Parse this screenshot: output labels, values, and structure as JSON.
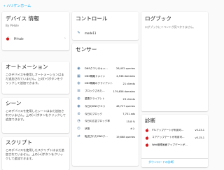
{
  "back_link": "ハリケンホーム",
  "device_info": {
    "title": "デバイス 情報",
    "subtitle": "By PiHole",
    "device_name": "PI-hole"
  },
  "automation": {
    "title": "オートメーション",
    "text": "このデバイスを使用しオートメーションはまだ追加されていません。上の[+]ボタンをクリックして追加できます。"
  },
  "scene": {
    "title": "シーン",
    "text": "このデバイスを使用したシーンはまだ追加されていません。上の[+]ボタンをクリックして追加できます。"
  },
  "script": {
    "title": "スクリプト",
    "text": "このデバイスを使用したスクリプトはまだ追加されていません。上の[+]ボタンをクリックして追加できます。"
  },
  "controls": {
    "title": "コントロール",
    "items": [
      {
        "label": "mode11"
      }
    ]
  },
  "sensors": {
    "title": "センサー",
    "items": [
      {
        "icon": "dns-icon",
        "name": "DNSクエリのキャ...",
        "value": "26,452 queries"
      },
      {
        "icon": "domain-icon",
        "name": "DNS隔離ドメイン",
        "value": "4,538 domains"
      },
      {
        "icon": "client-icon",
        "name": "DNS隔離のクライアント",
        "value": "21 clients"
      },
      {
        "icon": "list-icon",
        "name": "ブロックされた...",
        "value": "179,656 domains"
      },
      {
        "icon": "client-icon",
        "name": "重要クライアント",
        "value": "23 clients"
      },
      {
        "icon": "dns-icon",
        "name": "今日のDNSクエリ",
        "value": "48,727 queries"
      },
      {
        "icon": "block-icon",
        "name": "今日のブロック",
        "value": "7,701 ads"
      },
      {
        "icon": "percent-icon",
        "name": "今日の広告ブロック率",
        "value": "15.8 %"
      },
      {
        "icon": "state-icon",
        "name": "状態",
        "value": "オン"
      },
      {
        "icon": "forward-icon",
        "name": "転送されたDNSク...",
        "value": "19,668 queries"
      }
    ]
  },
  "logbook": {
    "title": "ログブック",
    "text": "ログブックにイベントが見つかりません。"
  },
  "diagnostics": {
    "title": "診断",
    "items": [
      {
        "name": "FTLアップデートが利用可...",
        "value": "v5.23.1"
      },
      {
        "name": "コアアップデートが利用可...",
        "value": "v5.15.1"
      },
      {
        "name": "Web管理画面アップデートが...",
        "value": ""
      }
    ],
    "footer": "ダウンロードの診断"
  },
  "colors": {
    "accent": "#03a9f4",
    "icon": "#44739e"
  }
}
